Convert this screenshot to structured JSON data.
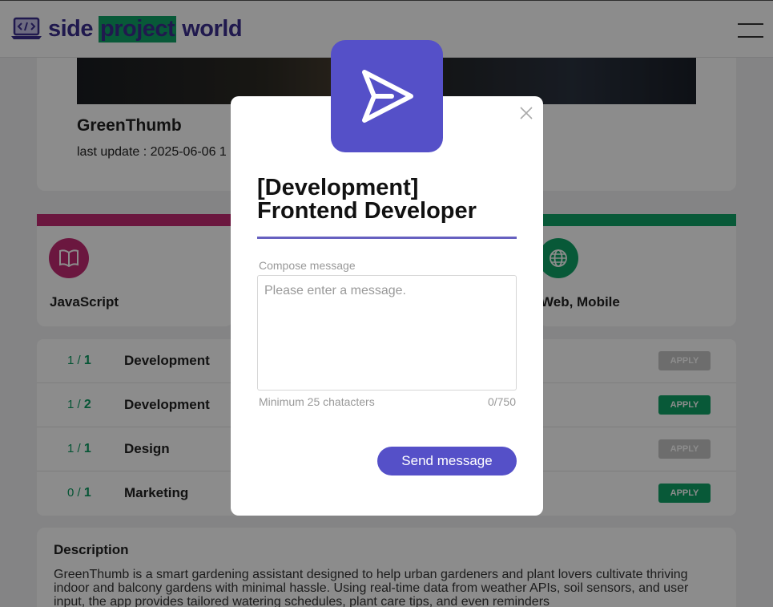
{
  "header": {
    "logo_left": "side",
    "logo_highlight": "project",
    "logo_right": "world"
  },
  "project": {
    "title": "GreenThumb",
    "last_update": "last update : 2025-06-06 1"
  },
  "tech_cards": [
    {
      "label": "JavaScript",
      "icon": "book-icon",
      "color": "#c42a74"
    },
    {
      "label": "Web, Mobile",
      "icon": "globe-icon",
      "color": "#0fa366"
    }
  ],
  "roles": [
    {
      "filled": "1",
      "total": "1",
      "name": "Development",
      "apply": "APPLY",
      "enabled": false
    },
    {
      "filled": "1",
      "total": "2",
      "name": "Development",
      "apply": "APPLY",
      "enabled": true
    },
    {
      "filled": "1",
      "total": "1",
      "name": "Design",
      "apply": "APPLY",
      "enabled": false
    },
    {
      "filled": "0",
      "total": "1",
      "name": "Marketing",
      "apply": "APPLY",
      "enabled": true
    }
  ],
  "description": {
    "title": "Description",
    "body": "GreenThumb is a smart gardening assistant designed to help urban gardeners and plant lovers cultivate thriving indoor and balcony gardens with minimal hassle. Using real-time data from weather APIs, soil sensors, and user input, the app provides tailored watering schedules, plant care tips, and even reminders"
  },
  "modal": {
    "title_line1": "[Development]",
    "title_line2": "Frontend Developer",
    "compose_label": "Compose message",
    "placeholder": "Please enter a message.",
    "hint": "Minimum 25 chatacters",
    "counter": "0/750",
    "send_label": "Send message",
    "icon": "send-icon",
    "accent": "#5550c8"
  },
  "colors": {
    "brand": "#3b2f8f",
    "green": "#0fa366",
    "pink": "#c42a74"
  }
}
